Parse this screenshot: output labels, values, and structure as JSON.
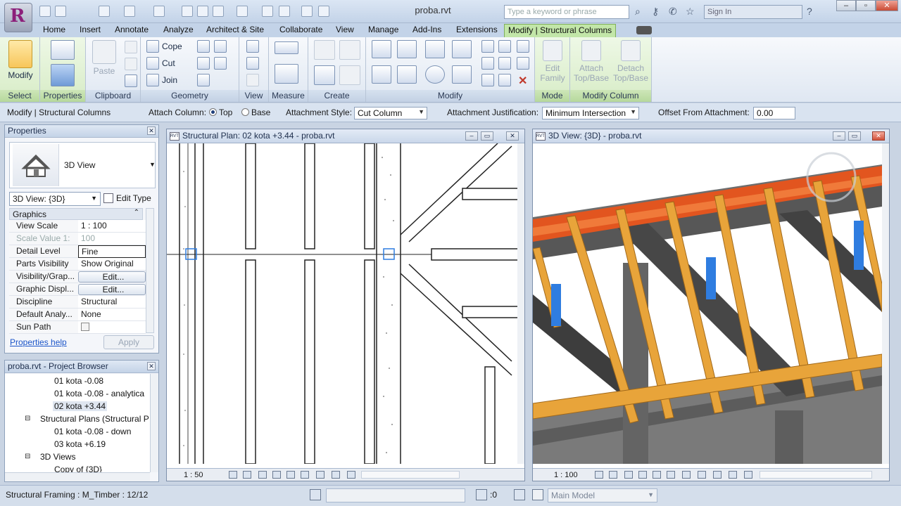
{
  "title_bar": {
    "doc_title": "proba.rvt",
    "search_placeholder": "Type a keyword or phrase",
    "help_text": "Sign In"
  },
  "tabs": [
    "Home",
    "Insert",
    "Annotate",
    "Analyze",
    "Architect & Site",
    "Collaborate",
    "View",
    "Manage",
    "Add-Ins",
    "Extensions",
    "Modify | Structural Columns"
  ],
  "active_tab": "Modify | Structural Columns",
  "ribbon": {
    "select": {
      "modify": "Modify",
      "label": "Select"
    },
    "properties": {
      "label": "Properties"
    },
    "clipboard": {
      "paste": "Paste",
      "label": "Clipboard"
    },
    "geometry": {
      "cope": "Cope",
      "cut": "Cut",
      "join": "Join",
      "label": "Geometry"
    },
    "view": {
      "label": "View"
    },
    "measure": {
      "label": "Measure"
    },
    "create": {
      "label": "Create"
    },
    "modify": {
      "label": "Modify"
    },
    "mode": {
      "edit_family_1": "Edit",
      "edit_family_2": "Family",
      "label": "Mode"
    },
    "modify_column": {
      "attach_1": "Attach",
      "attach_2": "Top/Base",
      "detach_1": "Detach",
      "detach_2": "Top/Base",
      "label": "Modify Column"
    }
  },
  "options_bar": {
    "context": "Modify | Structural Columns",
    "attach_column": "Attach Column:",
    "top": "Top",
    "base": "Base",
    "attachment_style_label": "Attachment Style:",
    "attachment_style": "Cut Column",
    "justification_label": "Attachment Justification:",
    "justification": "Minimum Intersection",
    "offset_label": "Offset From Attachment:",
    "offset": "0.00"
  },
  "properties": {
    "title": "Properties",
    "type_name": "3D View",
    "selector": "3D View: {3D}",
    "edit_type": "Edit Type",
    "group": "Graphics",
    "rows": [
      {
        "k": "View Scale",
        "v": "1 : 100"
      },
      {
        "k": "Scale Value    1:",
        "v": "100"
      },
      {
        "k": "Detail Level",
        "v": "Fine"
      },
      {
        "k": "Parts Visibility",
        "v": "Show Original"
      },
      {
        "k": "Visibility/Grap...",
        "v": "Edit..."
      },
      {
        "k": "Graphic Displ...",
        "v": "Edit..."
      },
      {
        "k": "Discipline",
        "v": "Structural"
      },
      {
        "k": "Default Analy...",
        "v": "None"
      },
      {
        "k": "Sun Path",
        "v": ""
      }
    ],
    "help": "Properties help",
    "apply": "Apply"
  },
  "browser": {
    "title": "proba.rvt - Project Browser",
    "items": [
      "01 kota -0.08",
      "01 kota -0.08 - analytica",
      "02 kota +3.44",
      "Structural Plans (Structural P",
      "01 kota -0.08 - down",
      "03 kota +6.19",
      "3D Views",
      "Copy of {3D}"
    ]
  },
  "plan_view": {
    "title": "Structural Plan: 02 kota +3.44 - proba.rvt",
    "scale": "1 : 50"
  },
  "view3d": {
    "title": "3D View: {3D} - proba.rvt",
    "scale": "1 : 100"
  },
  "status": {
    "text": "Structural Framing : M_Timber : 12/12",
    "count": ":0",
    "model": "Main Model"
  },
  "colors": {
    "ribbon_green": "#c2e6a8",
    "timber": "#e8a43a",
    "timber_sel": "#e2551f",
    "concrete": "#6f6f6f",
    "selection_blue": "#2f7de0"
  }
}
